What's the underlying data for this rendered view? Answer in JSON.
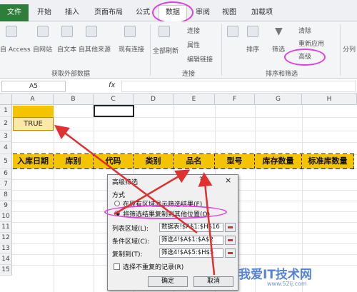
{
  "tabs": {
    "file": "文件",
    "home": "开始",
    "insert": "插入",
    "layout": "页面布局",
    "formulas": "公式",
    "data": "数据",
    "review": "审阅",
    "view": "视图",
    "addins": "加载项"
  },
  "ribbon": {
    "access": "自 Access",
    "web": "自网站",
    "text": "自文本",
    "other": "自其他来源",
    "existing": "现有连接",
    "refresh_all": "全部刷新",
    "connections": "连接",
    "properties": "属性",
    "edit_links": "编辑链接",
    "sort": "排序",
    "filter": "筛选",
    "clear": "清除",
    "reapply": "重新应用",
    "advanced": "高级",
    "split": "分列",
    "group_external": "获取外部数据",
    "group_connections": "连接",
    "group_sort_filter": "排序和筛选"
  },
  "formula_bar": {
    "name_box": "A5",
    "fx": "fx"
  },
  "columns": [
    "A",
    "B",
    "C",
    "D",
    "E",
    "F",
    "G",
    "H"
  ],
  "rows": [
    "1",
    "2",
    "3",
    "4",
    "5",
    "6",
    "7",
    "8",
    "9",
    "10",
    "11",
    "12",
    "13",
    "14",
    "15"
  ],
  "cells": {
    "a2": "TRUE"
  },
  "header_row": [
    "入库日期",
    "库别",
    "代码",
    "类别",
    "品名",
    "型号",
    "库存数量",
    "标准库数量"
  ],
  "dialog": {
    "title": "高级筛选",
    "help": "?",
    "close": "×",
    "mode_label": "方式",
    "option1": "在原有区域显示筛选结果(F)",
    "option2": "将筛选结果复制到其他位置(O)",
    "list_label": "列表区域(L):",
    "list_value": "数据表!$A$1:$H$16",
    "criteria_label": "条件区域(C):",
    "criteria_value": "筛选4!$A$1:$A$2",
    "copy_label": "复制到(T):",
    "copy_value": "筛选4!$A$5:$H$5",
    "unique_label": "选择不重复的记录(R)",
    "ok": "确定",
    "cancel": "取消"
  },
  "watermark": {
    "text": "我爱IT技术网",
    "url": "www.52ij.com"
  },
  "colors": {
    "accent_pink": "#e040e0",
    "arrow_red": "#e03030",
    "header_yellow": "#f5c400",
    "file_green": "#2e7d3a"
  }
}
